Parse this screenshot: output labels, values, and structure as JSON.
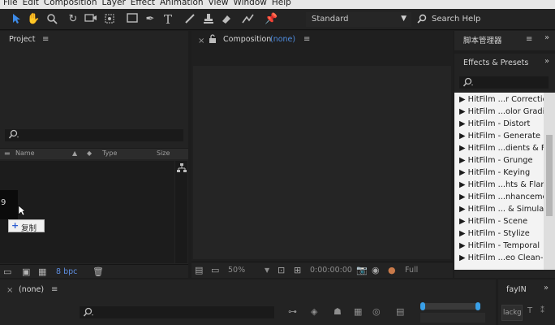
{
  "menubar": {
    "items": [
      "File",
      "Edit",
      "Composition",
      "Layer",
      "Effect",
      "Animation",
      "View",
      "Window",
      "Help"
    ]
  },
  "toolbar": {
    "tools": [
      "selection-tool-icon",
      "hand-tool-icon",
      "zoom-tool-icon",
      "rotate-tool-icon",
      "camera-tool-icon",
      "pan-behind-tool-icon",
      "rectangle-tool-icon",
      "pen-tool-icon",
      "type-tool-icon",
      "brush-tool-icon",
      "clone-stamp-tool-icon",
      "eraser-tool-icon",
      "roto-brush-tool-icon",
      "puppet-pin-tool-icon"
    ],
    "workspace": "Standard",
    "search_label": "Search Help"
  },
  "project": {
    "title": "Project",
    "columns": {
      "name": "Name",
      "type": "Type",
      "size": "Size"
    },
    "bpc": "8 bpc",
    "thumb_glyph": "9",
    "tooltip": "复制",
    "tooltip_plus": "+"
  },
  "composition": {
    "title": "Composition",
    "name": "(none)",
    "zoom": "50%",
    "timecode": "0:00:00:00",
    "resolution": "Full"
  },
  "scripts_panel": {
    "title": "脚本管理器"
  },
  "effects": {
    "title": "Effects & Presets",
    "items": [
      "▶ HitFilm ...r Correction",
      "▶ HitFilm ...olor Grading",
      "▶ HitFilm - Distort",
      "▶ HitFilm - Generate",
      "▶ HitFilm ...dients & Fills",
      "▶ HitFilm - Grunge",
      "▶ HitFilm - Keying",
      "▶ HitFilm ...hts & Flares",
      "▶ HitFilm ...nhancement",
      "▶ HitFilm ... & Simulatio",
      "▶ HitFilm - Scene",
      "▶ HitFilm - Stylize",
      "▶ HitFilm - Temporal",
      "▶ HitFilm ...eo Clean-up"
    ]
  },
  "timeline": {
    "title": "(none)"
  },
  "fayin": {
    "title": "fayIN",
    "chip": "lackg"
  },
  "overflow": "»"
}
